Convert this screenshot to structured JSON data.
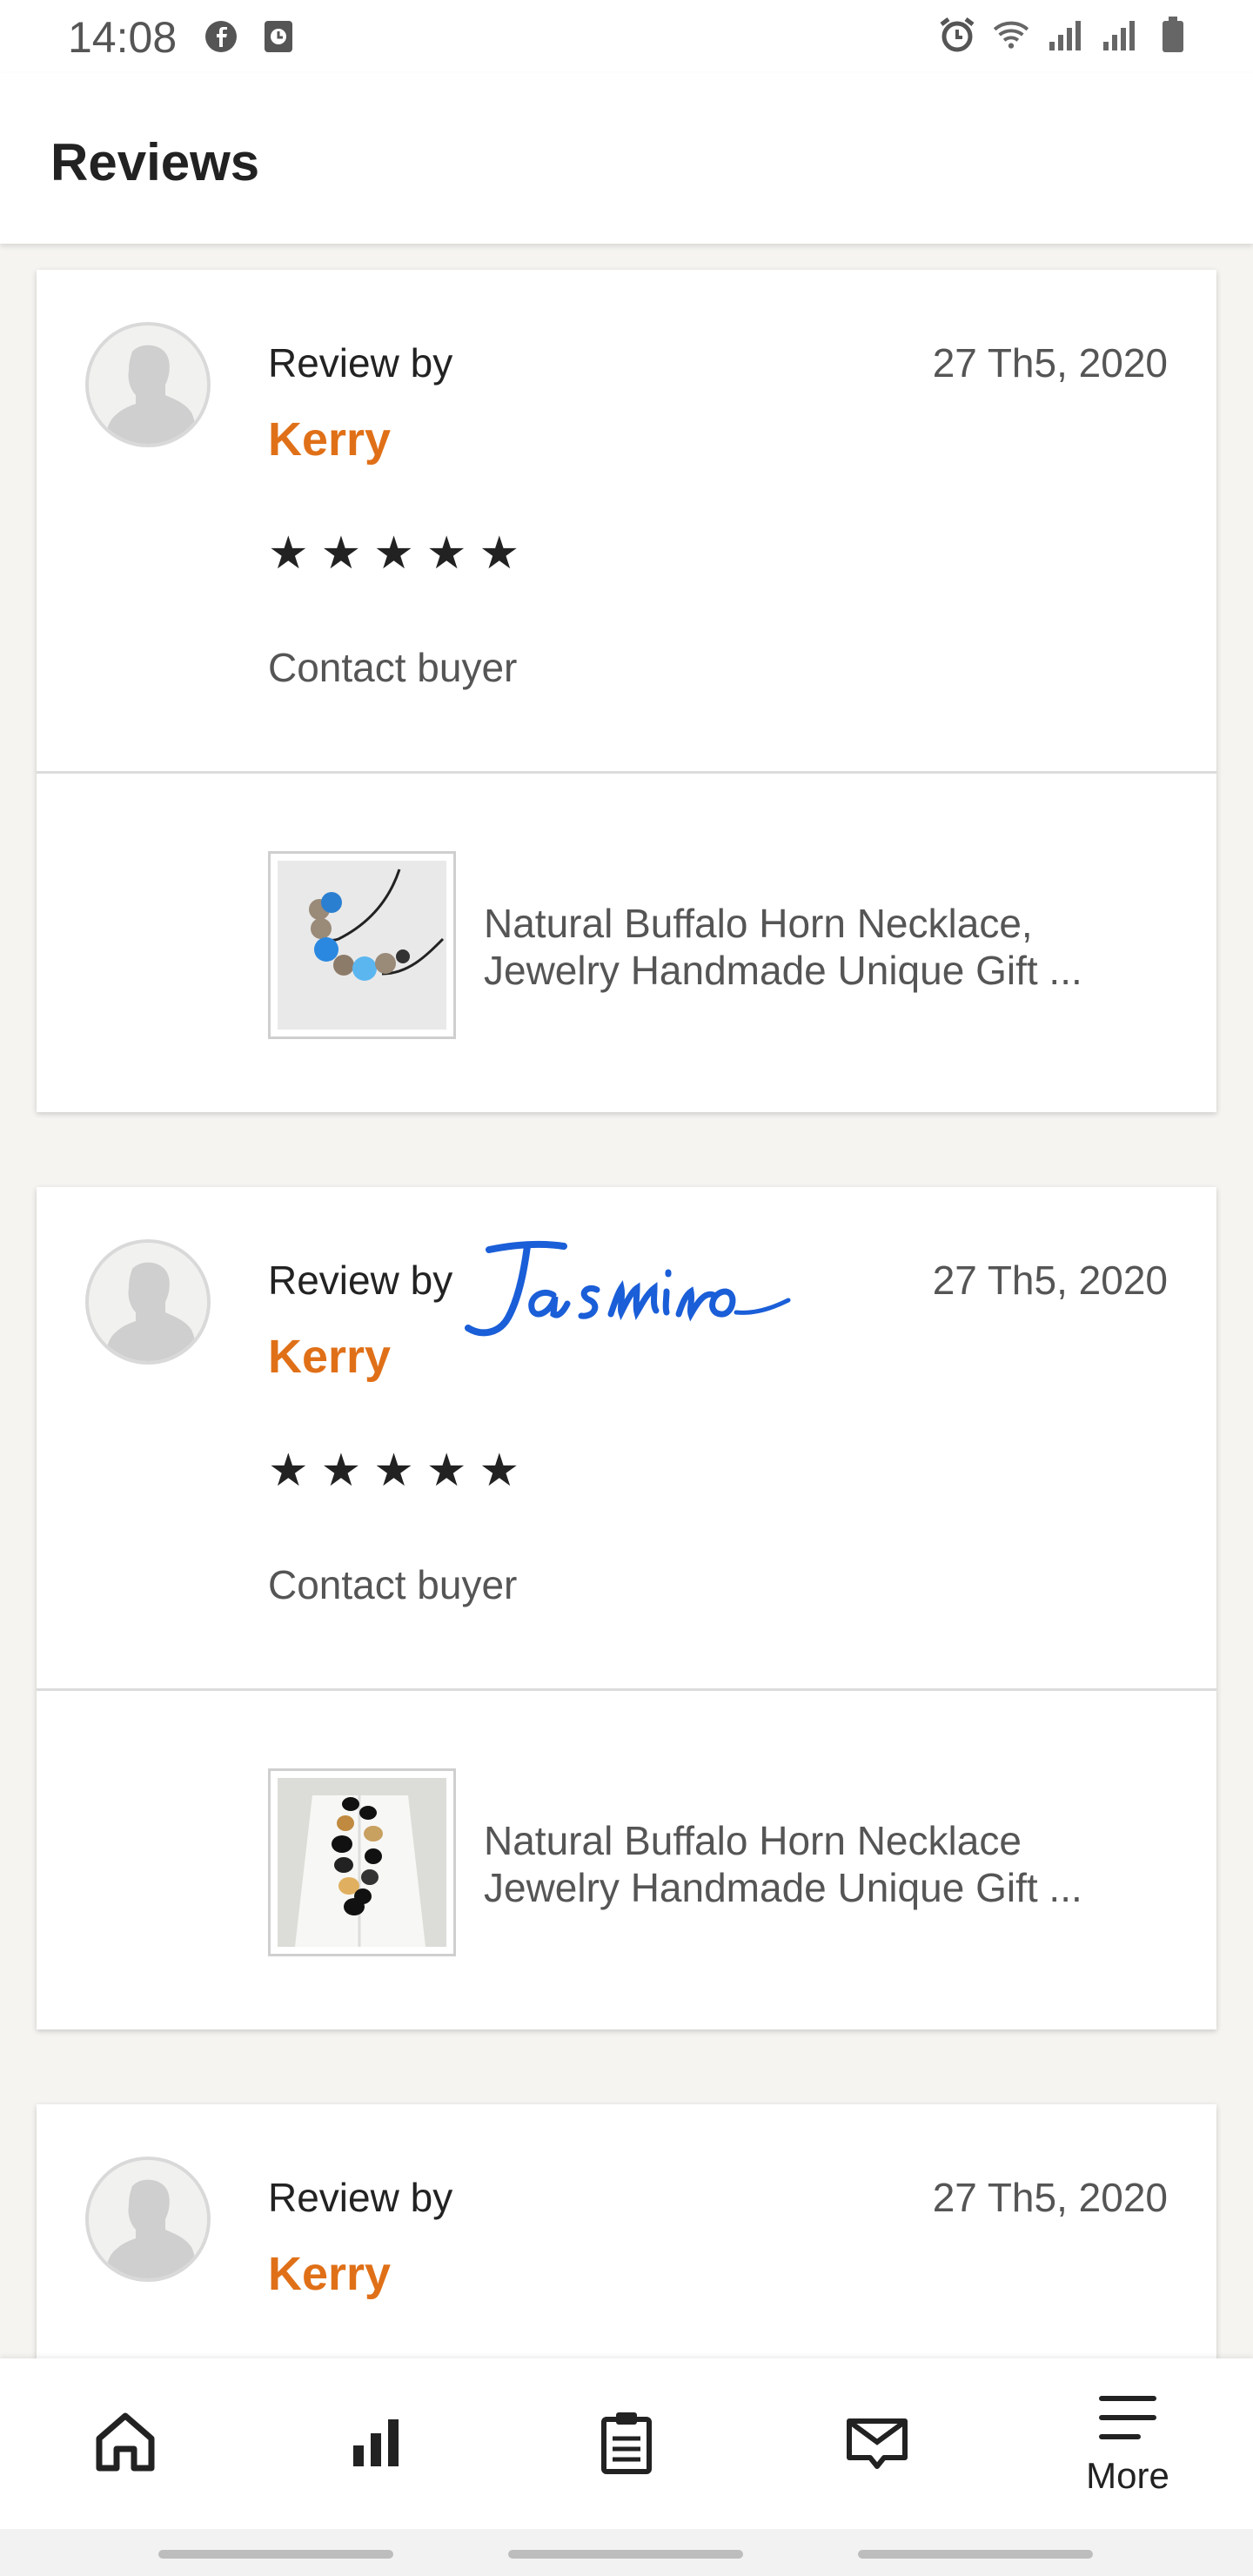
{
  "status_bar": {
    "time": "14:08",
    "left_icons": [
      "facebook-icon",
      "clock-app-icon"
    ],
    "right_icons": [
      "alarm-icon",
      "wifi-icon",
      "signal-icon",
      "signal-icon-2",
      "battery-icon"
    ]
  },
  "header": {
    "title": "Reviews"
  },
  "reviews": [
    {
      "review_by": "Review by",
      "name": "Kerry",
      "date": "27 Th5, 2020",
      "stars": "★★★★★",
      "rating": 5,
      "contact": "Contact buyer",
      "product_line1": "Natural Buffalo Horn Necklace,",
      "product_line2": "Jewelry Handmade Unique Gift ..."
    },
    {
      "review_by": "Review by",
      "name": "Kerry",
      "date": "27 Th5, 2020",
      "stars": "★★★★★",
      "rating": 5,
      "contact": "Contact buyer",
      "product_line1": "Natural Buffalo Horn Necklace",
      "product_line2": "Jewelry Handmade Unique Gift ..."
    },
    {
      "review_by": "Review by",
      "name": "Kerry",
      "date": "27 Th5, 2020"
    }
  ],
  "signature": {
    "text": "Jasmine",
    "color": "#1a5ed8"
  },
  "bottom_nav": {
    "items": [
      {
        "icon": "home-icon"
      },
      {
        "icon": "stats-icon"
      },
      {
        "icon": "orders-icon"
      },
      {
        "icon": "messages-icon"
      },
      {
        "icon": "menu-icon",
        "label": "More"
      }
    ]
  },
  "colors": {
    "accent": "#e07018",
    "background": "#f5f4f1"
  }
}
